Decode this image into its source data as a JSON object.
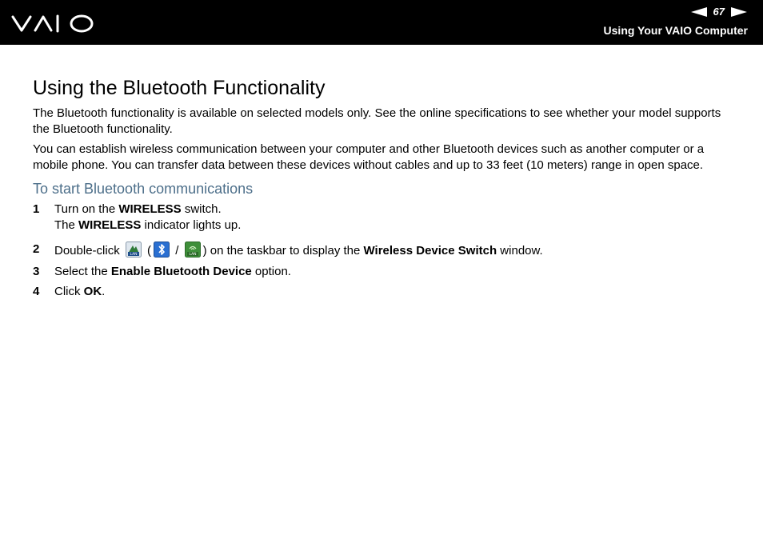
{
  "header": {
    "logo": "VAIO",
    "page_number": "67",
    "section_title": "Using Your VAIO Computer"
  },
  "main": {
    "title": "Using the Bluetooth Functionality",
    "paragraphs": [
      "The Bluetooth functionality is available on selected models only. See the online specifications to see whether your model supports the Bluetooth functionality.",
      "You can establish wireless communication between your computer and other Bluetooth devices such as another computer or a mobile phone. You can transfer data between these devices without cables and up to 33 feet (10 meters) range in open space."
    ],
    "procedure_title": "To start Bluetooth communications",
    "steps": [
      {
        "num": "1",
        "line1_a": "Turn on the ",
        "line1_b": "WIRELESS",
        "line1_c": " switch.",
        "line2_a": "The ",
        "line2_b": "WIRELESS",
        "line2_c": " indicator lights up."
      },
      {
        "num": "2",
        "a": "Double-click ",
        "b": " (",
        "c": " / ",
        "d": ") on the taskbar to display the ",
        "e": "Wireless Device Switch",
        "f": " window."
      },
      {
        "num": "3",
        "a": "Select the ",
        "b": "Enable Bluetooth Device",
        "c": " option."
      },
      {
        "num": "4",
        "a": "Click ",
        "b": "OK",
        "c": "."
      }
    ]
  },
  "colors": {
    "header_bg": "#000000",
    "subhead": "#4d6f8a"
  },
  "icons": [
    "vaio-logo",
    "previous-page-arrow-icon",
    "next-page-arrow-icon",
    "wireless-lan-tray-icon",
    "bluetooth-tray-icon",
    "wireless-lan-tray-icon"
  ]
}
